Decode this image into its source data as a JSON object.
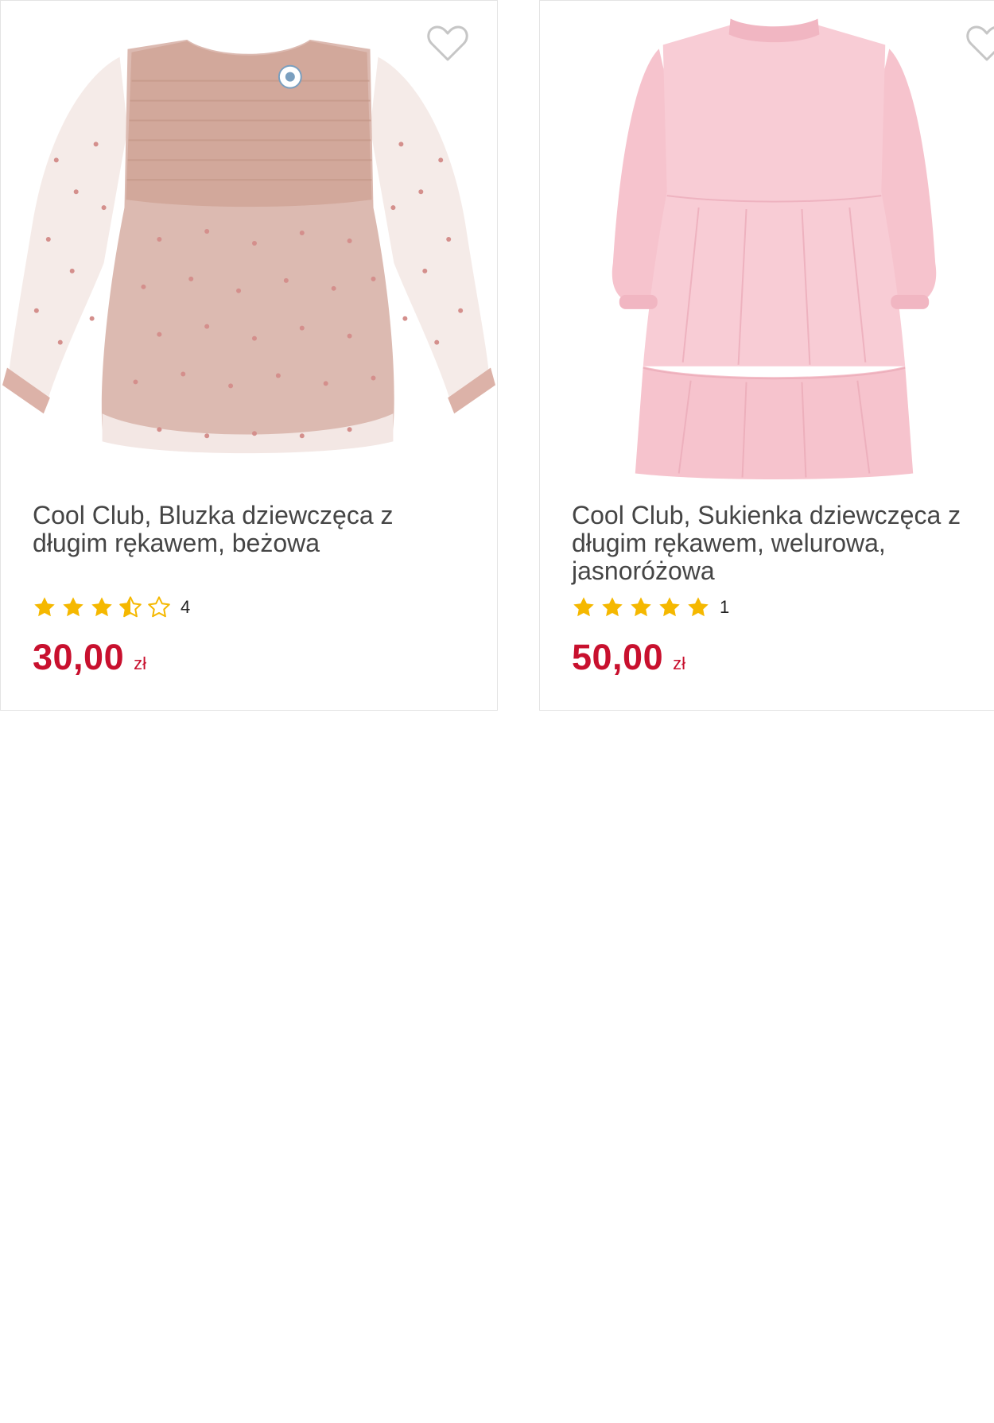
{
  "products": [
    {
      "title": "Cool Club, Bluzka dziewczęca z długim rękawem, beżowa",
      "rating_stars": 3.5,
      "rating_count": "4",
      "price": "30,00",
      "currency": "zł",
      "favorite_icon": "heart-outline-icon",
      "colors": {
        "garment": "#d9b5aa",
        "sleeve": "#f3e6e2",
        "dots": "#d48f8c"
      }
    },
    {
      "title": "Cool Club, Sukienka dziewczęca z długim rękawem, welurowa, jasnoróżowa",
      "rating_stars": 5,
      "rating_count": "1",
      "price": "50,00",
      "currency": "zł",
      "favorite_icon": "heart-outline-icon",
      "colors": {
        "garment": "#f6c3cd"
      }
    }
  ],
  "colors": {
    "price": "#c8102e",
    "star": "#f5b800",
    "title": "#454545",
    "border": "#e3e3e3"
  }
}
